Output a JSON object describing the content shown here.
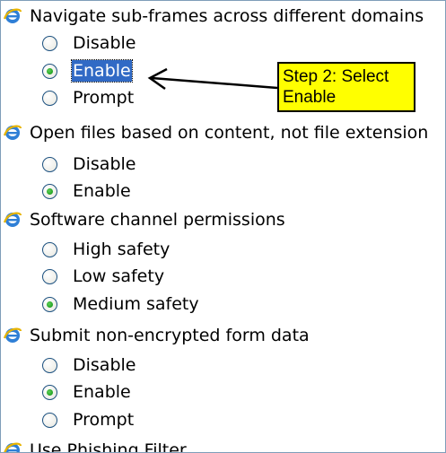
{
  "settings": [
    {
      "title": "Navigate sub-frames across different domains",
      "options": [
        "Disable",
        "Enable",
        "Prompt"
      ],
      "selected": 1
    },
    {
      "title": "Open files based on content, not file extension",
      "options": [
        "Disable",
        "Enable"
      ],
      "selected": 1
    },
    {
      "title": "Software channel permissions",
      "options": [
        "High safety",
        "Low safety",
        "Medium safety"
      ],
      "selected": 2
    },
    {
      "title": "Submit non-encrypted form data",
      "options": [
        "Disable",
        "Enable",
        "Prompt"
      ],
      "selected": 1
    },
    {
      "title": "Use Phishing Filter"
    }
  ],
  "annotation": {
    "callout_line1": "Step 2: Select",
    "callout_line2": "Enable"
  },
  "icons": {
    "category": "internet-explorer-icon",
    "radio": "radio-button"
  },
  "colors": {
    "selection_highlight": "#316ac5",
    "callout_background": "#ffff00",
    "radio_checked": "#21a121"
  }
}
